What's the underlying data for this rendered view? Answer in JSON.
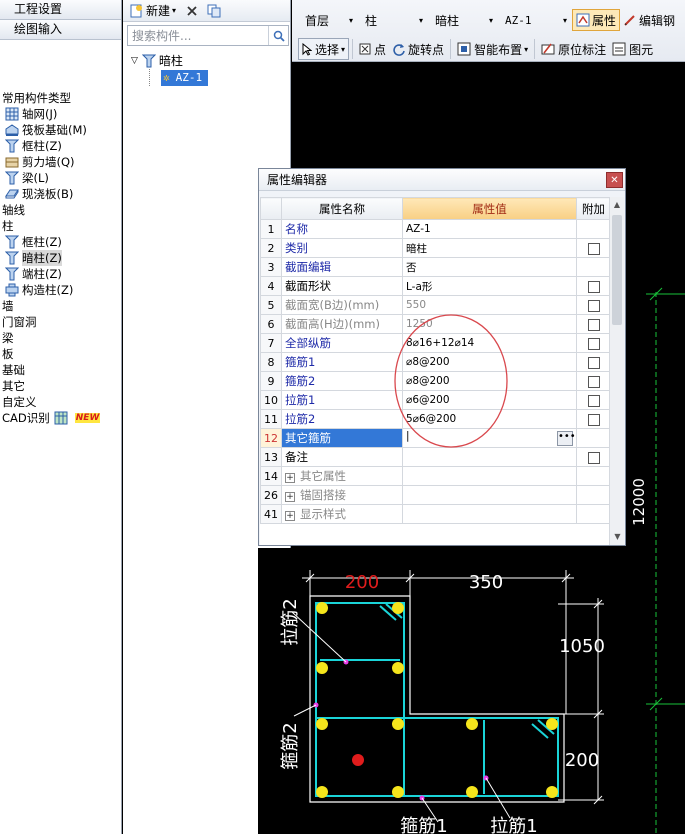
{
  "left_panel": {
    "tabs": [
      "工程设置",
      "绘图输入"
    ],
    "tree": [
      {
        "label": "常用构件类型",
        "icon": "none",
        "indent": 0
      },
      {
        "label": "轴网(J)",
        "icon": "grid-icon",
        "indent": 1
      },
      {
        "label": "筏板基础(M)",
        "icon": "raft-foundation-icon",
        "indent": 1
      },
      {
        "label": "框柱(Z)",
        "icon": "frame-column-icon",
        "indent": 1
      },
      {
        "label": "剪力墙(Q)",
        "icon": "shear-wall-icon",
        "indent": 1
      },
      {
        "label": "梁(L)",
        "icon": "beam-icon",
        "indent": 1
      },
      {
        "label": "现浇板(B)",
        "icon": "slab-icon",
        "indent": 1
      },
      {
        "label": "轴线",
        "icon": "none",
        "indent": 0
      },
      {
        "label": "柱",
        "icon": "none",
        "indent": 0
      },
      {
        "label": "框柱(Z)",
        "icon": "frame-column-icon",
        "indent": 1
      },
      {
        "label": "暗柱(Z)",
        "icon": "hidden-column-icon",
        "indent": 1,
        "selected": true
      },
      {
        "label": "端柱(Z)",
        "icon": "end-column-icon",
        "indent": 1
      },
      {
        "label": "构造柱(Z)",
        "icon": "constructional-column-icon",
        "indent": 1
      },
      {
        "label": "墙",
        "icon": "none",
        "indent": 0
      },
      {
        "label": "门窗洞",
        "icon": "none",
        "indent": 0
      },
      {
        "label": "梁",
        "icon": "none",
        "indent": 0
      },
      {
        "label": "板",
        "icon": "none",
        "indent": 0
      },
      {
        "label": "基础",
        "icon": "none",
        "indent": 0
      },
      {
        "label": "其它",
        "icon": "none",
        "indent": 0
      },
      {
        "label": "自定义",
        "icon": "none",
        "indent": 0
      },
      {
        "label": "CAD识别",
        "icon": "cad-icon",
        "indent": 0,
        "badge": "NEW"
      }
    ]
  },
  "mid_panel": {
    "new_label": "新建",
    "search_placeholder": "搜索构件...",
    "tree_parent": "暗柱",
    "tree_child": "AZ-1"
  },
  "toolbar1": {
    "floor": "首层",
    "type": "柱",
    "subtype": "暗柱",
    "component": "AZ-1",
    "property_btn": "属性",
    "edit_btn": "编辑钢"
  },
  "toolbar2": {
    "select": "选择",
    "point": "点",
    "rotate_point": "旋转点",
    "smart_layout": "智能布置",
    "original_mark": "原位标注",
    "figure": "图元"
  },
  "prop_editor": {
    "title": "属性编辑器",
    "headers": {
      "name": "属性名称",
      "value": "属性值",
      "extra": "附加"
    },
    "rows": [
      {
        "num": "1",
        "name": "名称",
        "value": "AZ-1",
        "style": "blue",
        "checkbox": false
      },
      {
        "num": "2",
        "name": "类别",
        "value": "暗柱",
        "style": "blue",
        "checkbox": true
      },
      {
        "num": "3",
        "name": "截面编辑",
        "value": "否",
        "style": "blue",
        "checkbox": false
      },
      {
        "num": "4",
        "name": "截面形状",
        "value": "L-a形",
        "style": "black",
        "checkbox": true
      },
      {
        "num": "5",
        "name": "截面宽(B边)(mm)",
        "value": "550",
        "style": "gray",
        "checkbox": true
      },
      {
        "num": "6",
        "name": "截面高(H边)(mm)",
        "value": "1250",
        "style": "gray",
        "checkbox": true
      },
      {
        "num": "7",
        "name": "全部纵筋",
        "value": "8⌀16+12⌀14",
        "style": "blue",
        "checkbox": true
      },
      {
        "num": "8",
        "name": "箍筋1",
        "value": "⌀8@200",
        "style": "blue",
        "checkbox": true
      },
      {
        "num": "9",
        "name": "箍筋2",
        "value": "⌀8@200",
        "style": "blue",
        "checkbox": true
      },
      {
        "num": "10",
        "name": "拉筋1",
        "value": "⌀6@200",
        "style": "blue",
        "checkbox": true
      },
      {
        "num": "11",
        "name": "拉筋2",
        "value": "5⌀6@200",
        "style": "blue",
        "checkbox": true
      },
      {
        "num": "12",
        "name": "其它箍筋",
        "value": "",
        "style": "current",
        "checkbox": false
      },
      {
        "num": "13",
        "name": "备注",
        "value": "",
        "style": "black",
        "checkbox": true
      },
      {
        "num": "14",
        "name": "其它属性",
        "value": "",
        "style": "group",
        "checkbox": false
      },
      {
        "num": "26",
        "name": "锚固搭接",
        "value": "",
        "style": "group",
        "checkbox": false
      },
      {
        "num": "41",
        "name": "显示样式",
        "value": "",
        "style": "group",
        "checkbox": false
      }
    ]
  },
  "section_preview": {
    "dim_top_left": "200",
    "dim_top_right": "350",
    "dim_right_top": "1050",
    "dim_right_bottom": "200",
    "label_tie2": "拉筋2",
    "label_stirrup2": "箍筋2",
    "label_stirrup1": "箍筋1",
    "label_tie1": "拉筋1"
  },
  "canvas": {
    "dim_label": "12000"
  },
  "colors": {
    "rebar_outline": "#1ad4d8",
    "main_bar": "#f5e51c",
    "dim_text": "#ffffff",
    "dim_highlight": "#e01c1c",
    "grid_green": "#19c23a",
    "selection": "#3378d7"
  }
}
